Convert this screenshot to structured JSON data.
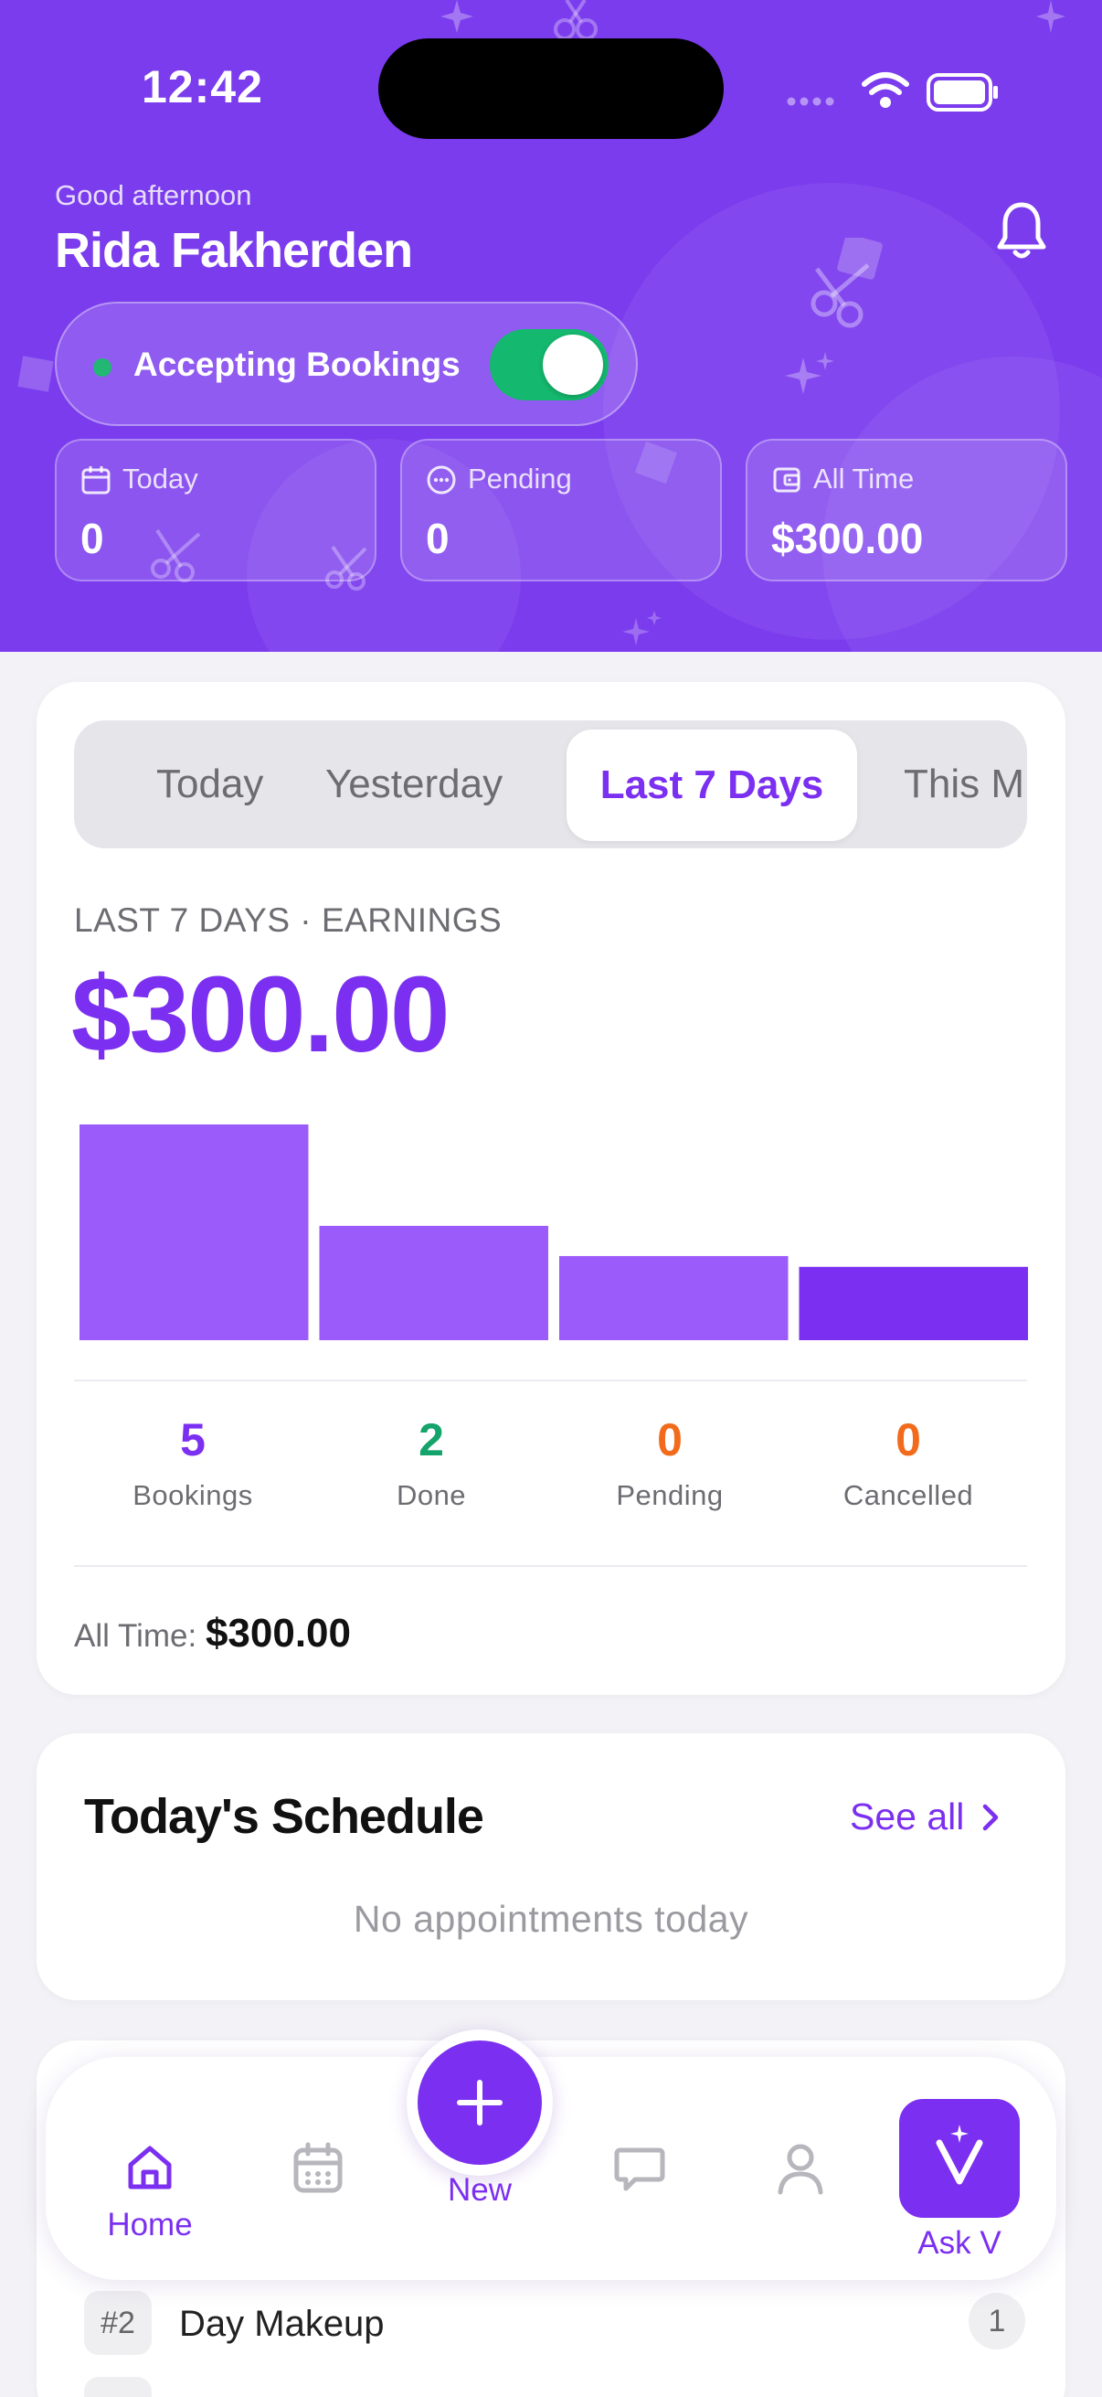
{
  "status_bar": {
    "time": "12:42"
  },
  "header": {
    "greeting": "Good afternoon",
    "user_name": "Rida Fakherden",
    "accepting_label": "Accepting Bookings",
    "accepting_on": true,
    "stats": [
      {
        "label": "Today",
        "value": "0",
        "icon": "calendar-icon"
      },
      {
        "label": "Pending",
        "value": "0",
        "icon": "dots-circle-icon"
      },
      {
        "label": "All Time",
        "value": "$300.00",
        "icon": "wallet-icon"
      }
    ]
  },
  "earnings": {
    "tabs": [
      "Today",
      "Yesterday",
      "Last 7 Days",
      "This M"
    ],
    "active_tab": "Last 7 Days",
    "title": "LAST 7 DAYS · EARNINGS",
    "amount": "$300.00",
    "metrics": [
      {
        "value": "5",
        "label": "Bookings",
        "color": "#7b2ff0"
      },
      {
        "value": "2",
        "label": "Done",
        "color": "#14a36a"
      },
      {
        "value": "0",
        "label": "Pending",
        "color": "#f26b1d"
      },
      {
        "value": "0",
        "label": "Cancelled",
        "color": "#f26b1d"
      }
    ],
    "all_time_label": "All Time:",
    "all_time_value": "$300.00"
  },
  "chart_data": {
    "type": "bar",
    "categories": [
      "",
      "",
      "",
      ""
    ],
    "values": [
      100,
      53,
      39,
      34
    ],
    "colors": [
      "#9b5bfa",
      "#9b5bfa",
      "#9b5bfa",
      "#7b2ff0"
    ]
  },
  "schedule": {
    "title": "Today's Schedule",
    "see_all": "See all",
    "empty": "No appointments today"
  },
  "top_services": [
    {
      "rank": "#2",
      "name": "Day Makeup",
      "count": "1"
    }
  ],
  "nav": {
    "home": "Home",
    "new": "New",
    "ask": "Ask V",
    "accent": "#7b2ff0"
  }
}
